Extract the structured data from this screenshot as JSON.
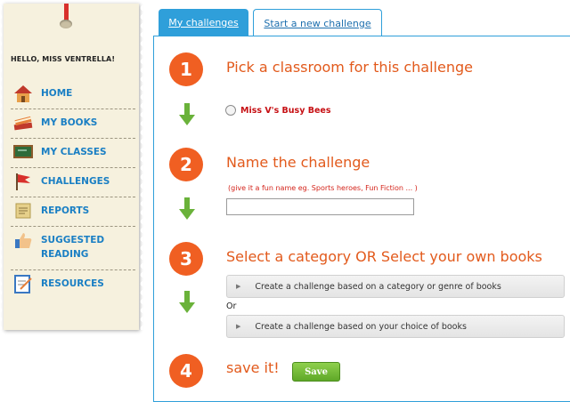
{
  "sidebar": {
    "greeting": "HELLO, MISS VENTRELLA!",
    "items": [
      {
        "label": "HOME",
        "icon": "house-icon"
      },
      {
        "label": "MY BOOKS",
        "icon": "books-icon"
      },
      {
        "label": "MY CLASSES",
        "icon": "chalkboard-icon"
      },
      {
        "label": "CHALLENGES",
        "icon": "flag-icon"
      },
      {
        "label": "REPORTS",
        "icon": "scroll-icon"
      },
      {
        "label": "SUGGESTED READING",
        "icon": "thumbs-up-icon"
      },
      {
        "label": "RESOURCES",
        "icon": "notepad-icon"
      }
    ]
  },
  "tabs": [
    {
      "label": "My challenges",
      "active": true
    },
    {
      "label": "Start a new challenge",
      "active": false
    }
  ],
  "steps": [
    {
      "number": "1",
      "title": "Pick a classroom for this challenge"
    },
    {
      "number": "2",
      "title": "Name the challenge"
    },
    {
      "number": "3",
      "title": "Select a category OR Select your own books"
    },
    {
      "number": "4",
      "title": "save it!"
    }
  ],
  "classroom_option": "Miss V's Busy Bees",
  "name_hint": "(give it a fun name eg. Sports heroes, Fun Fiction ... )",
  "name_value": "",
  "category_option": "Create a challenge based on a category or genre of books",
  "or_label": "Or",
  "books_option": "Create a challenge based on your choice of books",
  "save_label": "Save",
  "colors": {
    "accent_blue": "#2f9fda",
    "step_orange": "#f05f22",
    "arrow_green": "#6ab23a",
    "link_blue": "#1a7fc4",
    "hint_red": "#d4241b",
    "save_green": "#6cb831"
  }
}
